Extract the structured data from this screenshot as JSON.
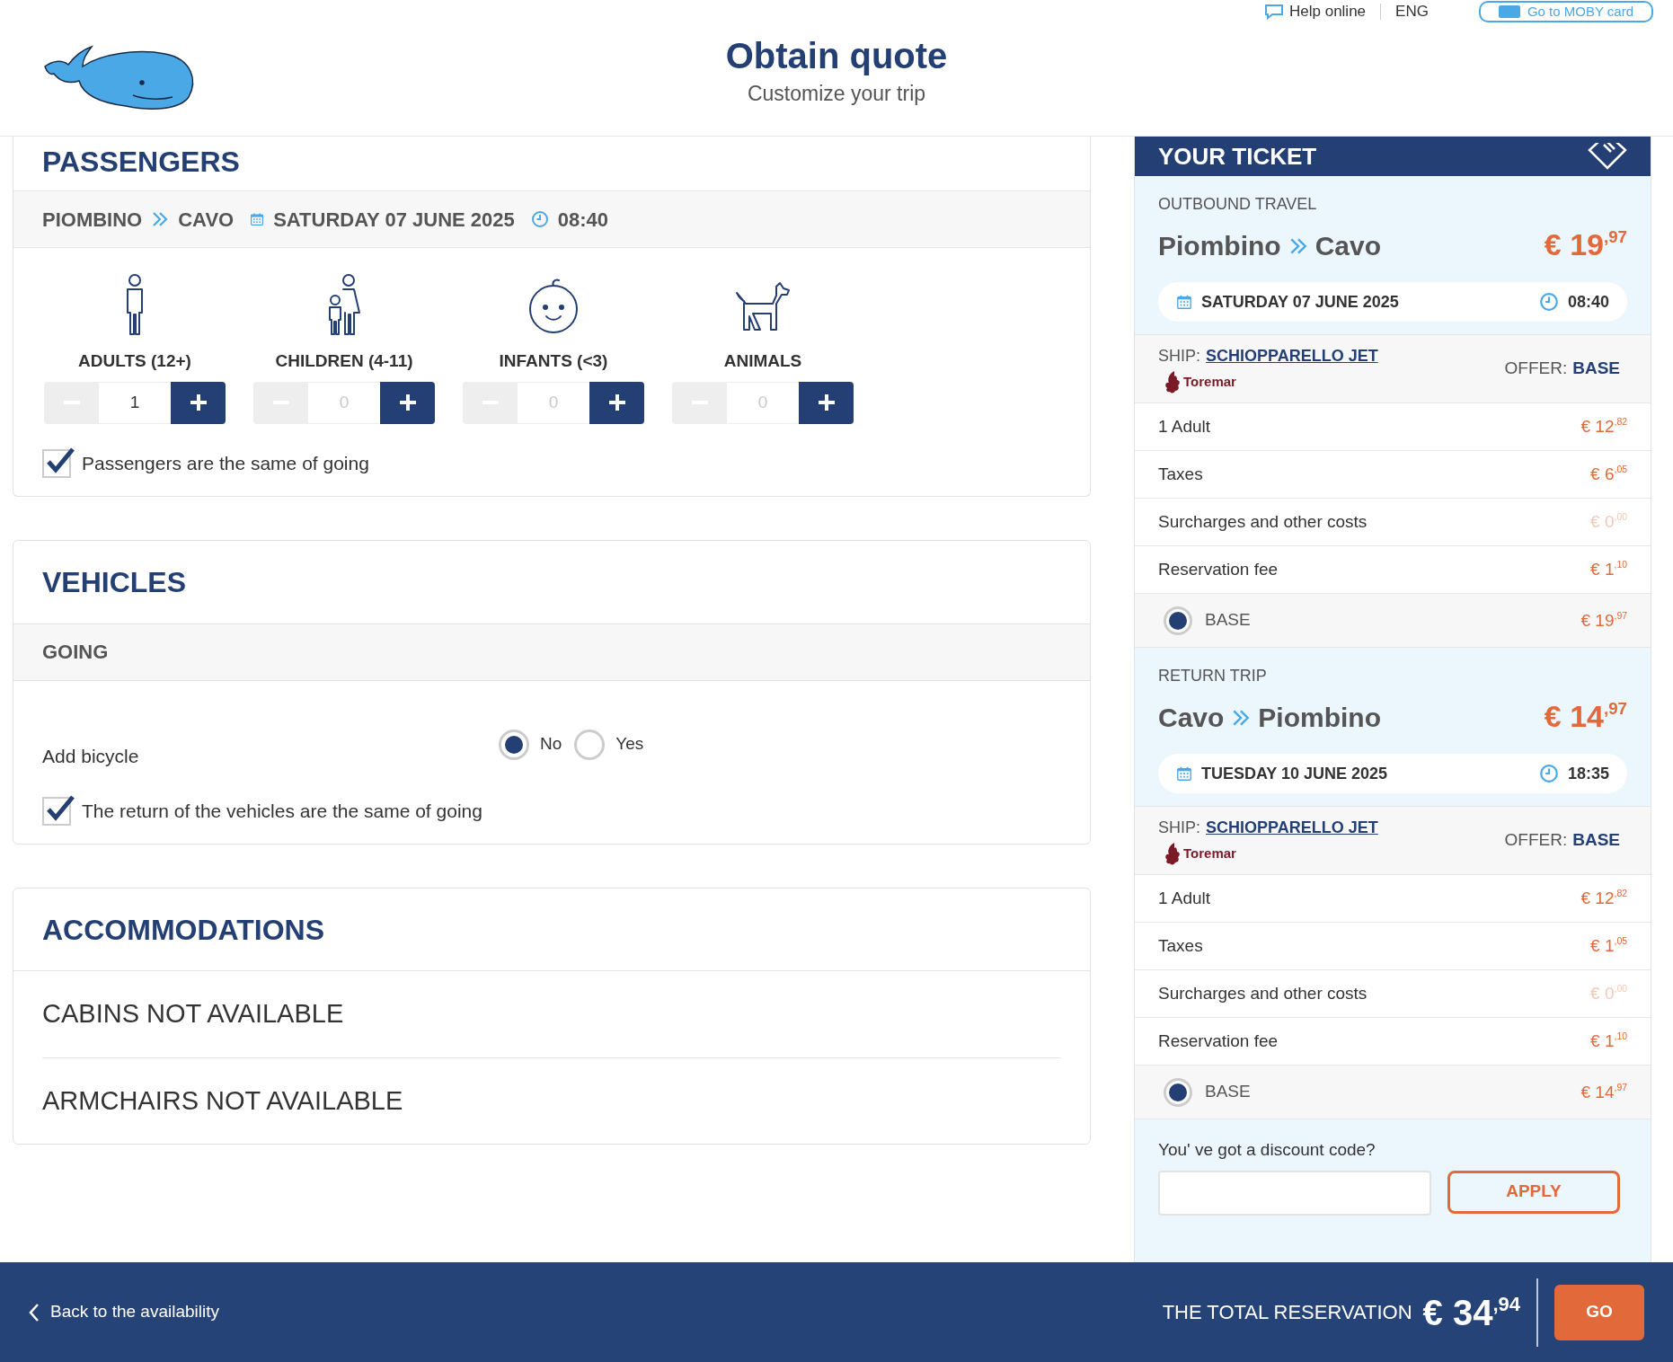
{
  "top_links": {
    "help": "Help online",
    "language": "ENG",
    "card_button": "Go to MOBY card"
  },
  "header": {
    "title": "Obtain quote",
    "subtitle": "Customize your trip"
  },
  "passengers": {
    "title": "PASSENGERS",
    "route": {
      "from": "PIOMBINO",
      "to": "CAVO",
      "date": "SATURDAY 07 JUNE 2025",
      "time": "08:40"
    },
    "types": [
      {
        "kind": "adult",
        "label": "ADULTS (12+)",
        "count": "1",
        "dimmed": false
      },
      {
        "kind": "child",
        "label": "CHILDREN (4-11)",
        "count": "0",
        "dimmed": true
      },
      {
        "kind": "infant",
        "label": "INFANTS (<3)",
        "count": "0",
        "dimmed": true
      },
      {
        "kind": "animal",
        "label": "ANIMALS",
        "count": "0",
        "dimmed": true
      }
    ],
    "same_checkbox": {
      "label": "Passengers are the same of going",
      "checked": true
    }
  },
  "vehicles": {
    "title": "VEHICLES",
    "section": "GOING",
    "bicycle": {
      "label": "Add bicycle",
      "options": [
        {
          "label": "No",
          "selected": true
        },
        {
          "label": "Yes",
          "selected": false
        }
      ]
    },
    "same_checkbox": {
      "label": "The return of the vehicles are the same of going",
      "checked": true
    }
  },
  "accommodations": {
    "title": "ACCOMMODATIONS",
    "items": [
      "CABINS NOT AVAILABLE",
      "ARMCHAIRS NOT AVAILABLE"
    ]
  },
  "ticket": {
    "title": "YOUR TICKET",
    "trips": [
      {
        "heading": "OUTBOUND TRAVEL",
        "from": "Piombino",
        "to": "Cavo",
        "price": "€ 19$^{,97}$",
        "date": "SATURDAY 07 JUNE 2025",
        "time": "08:40",
        "ship_label": "SHIP:",
        "ship": "SCHIOPPARELLO JET",
        "operator": "Toremar",
        "offer_label": "OFFER:",
        "offer": "BASE",
        "lines": [
          {
            "label": "1 Adult",
            "amount": "€ 12$^{,82}$",
            "muted": false
          },
          {
            "label": "Taxes",
            "amount": "€ 6$^{,05}$",
            "muted": false
          },
          {
            "label": "Surcharges and other costs",
            "amount": "€ 0$^{,00}$",
            "muted": true
          },
          {
            "label": "Reservation fee",
            "amount": "€ 1$^{,10}$",
            "muted": false
          }
        ],
        "fare": {
          "label": "BASE",
          "amount": "€ 19$^{,97}$",
          "selected": true
        }
      },
      {
        "heading": "RETURN TRIP",
        "from": "Cavo",
        "to": "Piombino",
        "price": "€ 14$^{,97}$",
        "date": "TUESDAY 10 JUNE 2025",
        "time": "18:35",
        "ship_label": "SHIP:",
        "ship": "SCHIOPPARELLO JET",
        "operator": "Toremar",
        "offer_label": "OFFER:",
        "offer": "BASE",
        "lines": [
          {
            "label": "1 Adult",
            "amount": "€ 12$^{,82}$",
            "muted": false
          },
          {
            "label": "Taxes",
            "amount": "€ 1$^{,05}$",
            "muted": false
          },
          {
            "label": "Surcharges and other costs",
            "amount": "€ 0$^{,00}$",
            "muted": true
          },
          {
            "label": "Reservation fee",
            "amount": "€ 1$^{,10}$",
            "muted": false
          }
        ],
        "fare": {
          "label": "BASE",
          "amount": "€ 14$^{,97}$",
          "selected": true
        }
      }
    ],
    "discount": {
      "label": "You' ve got a discount code?",
      "button": "APPLY"
    }
  },
  "footer": {
    "back": "Back to the availability",
    "total_label": "THE TOTAL RESERVATION",
    "total": "€ 34$^{,94}$",
    "go": "GO"
  }
}
